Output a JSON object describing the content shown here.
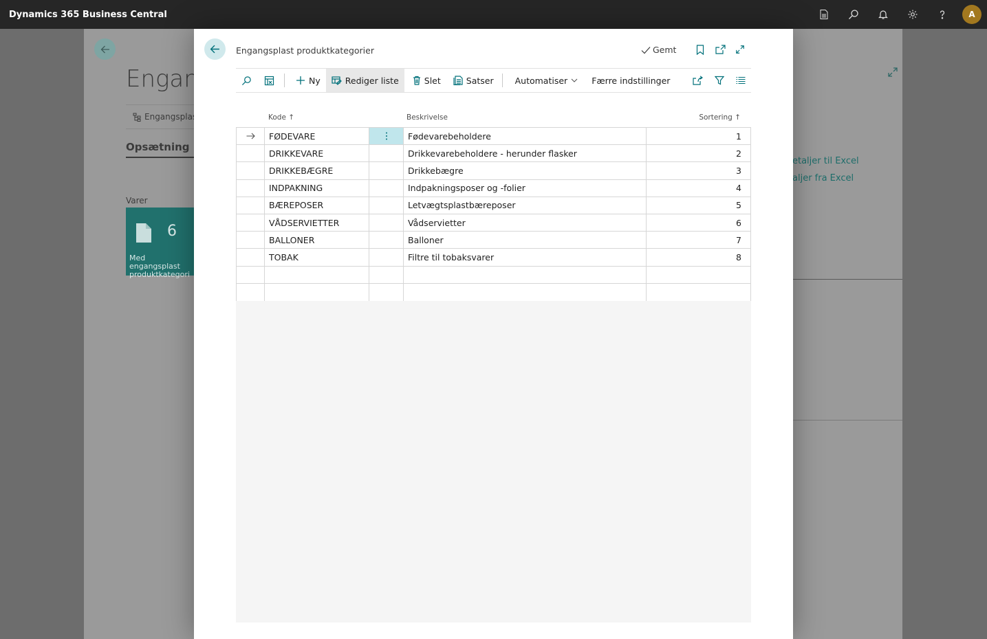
{
  "app": {
    "title": "Dynamics 365 Business Central",
    "avatar_initial": "A"
  },
  "background": {
    "title": "Engang",
    "tab_label": "Engangsplast",
    "section": "Opsætning",
    "tile_group": "Varer",
    "tile_count": "6",
    "tile_label": "Med engangsplast produktkategori",
    "excel_link_1": "etaljer til Excel",
    "excel_link_2": "aljer fra Excel"
  },
  "dialog": {
    "title": "Engangsplast produktkategorier",
    "saved_label": "Gemt",
    "actions": {
      "new": "Ny",
      "edit_list": "Rediger liste",
      "delete": "Slet",
      "rates": "Satser",
      "automate": "Automatiser",
      "fewer_options": "Færre indstillinger"
    },
    "columns": {
      "code": "Kode ↑",
      "description": "Beskrivelse",
      "sorting": "Sortering ↑"
    },
    "rows": [
      {
        "code": "FØDEVARE",
        "description": "Fødevarebeholdere",
        "sorting": "1"
      },
      {
        "code": "DRIKKEVARE",
        "description": "Drikkevarebeholdere - herunder flasker",
        "sorting": "2"
      },
      {
        "code": "DRIKKEBÆGRE",
        "description": "Drikkebægre",
        "sorting": "3"
      },
      {
        "code": "INDPAKNING",
        "description": "Indpakningsposer og -folier",
        "sorting": "4"
      },
      {
        "code": "BÆREPOSER",
        "description": "Letvægtsplastbæreposer",
        "sorting": "5"
      },
      {
        "code": "VÅDSERVIETTER",
        "description": "Vådservietter",
        "sorting": "6"
      },
      {
        "code": "BALLONER",
        "description": "Balloner",
        "sorting": "7"
      },
      {
        "code": "TOBAK",
        "description": "Filtre til tobaksvarer",
        "sorting": "8"
      }
    ],
    "empty_rows": 2
  },
  "colors": {
    "accent": "#00818a",
    "appbar": "#262626",
    "tile": "#21716d",
    "selected_cell": "#c0e6ec"
  }
}
